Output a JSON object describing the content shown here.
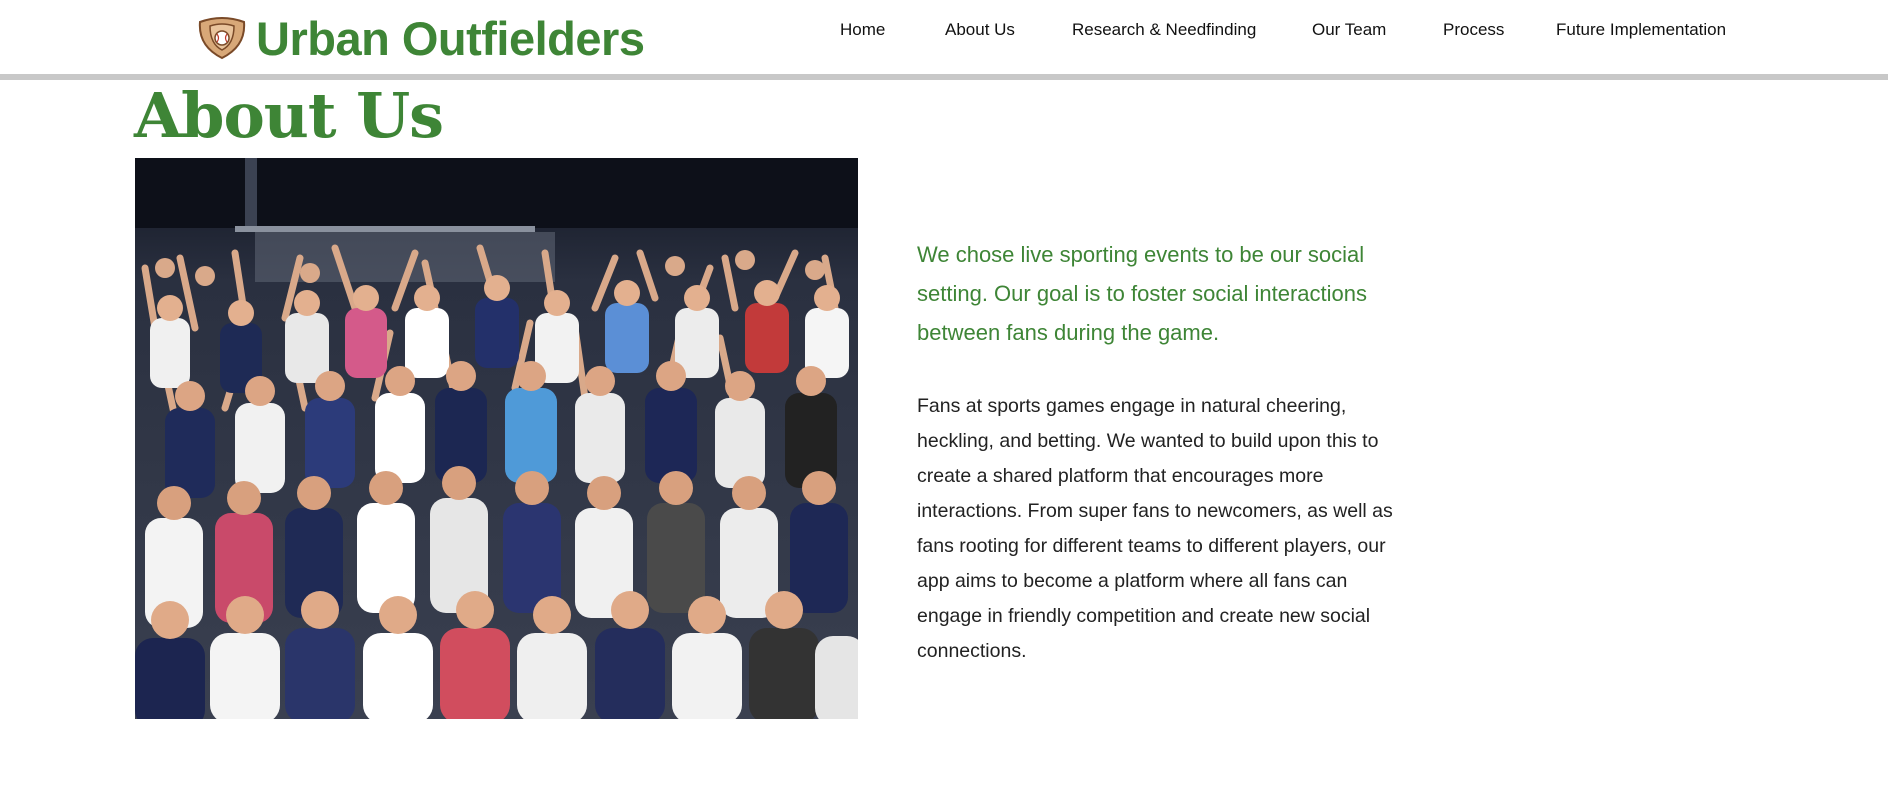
{
  "site": {
    "name": "Urban Outfielders",
    "logo_icon": "baseball-glove-icon",
    "brand_color": "#3e8536"
  },
  "nav": {
    "items": [
      {
        "label": "Home"
      },
      {
        "label": "About Us"
      },
      {
        "label": "Research & Needfinding"
      },
      {
        "label": "Our Team"
      },
      {
        "label": "Process"
      },
      {
        "label": "Future Implementation"
      }
    ]
  },
  "main": {
    "title": "About Us",
    "lead": "We chose live sporting events to be our social setting. Our goal is to foster social interactions between fans during the game.",
    "body": "Fans at sports games engage in natural cheering, heckling, and betting. We wanted to build upon this to create a shared platform that encourages more interactions. From super fans to newcomers, as well as fans rooting for different teams to different players, our app aims to become a platform where all fans can engage in friendly competition and create new social connections."
  },
  "colors": {
    "text_dark": "#222222",
    "header_rule": "#c8c8c8"
  }
}
